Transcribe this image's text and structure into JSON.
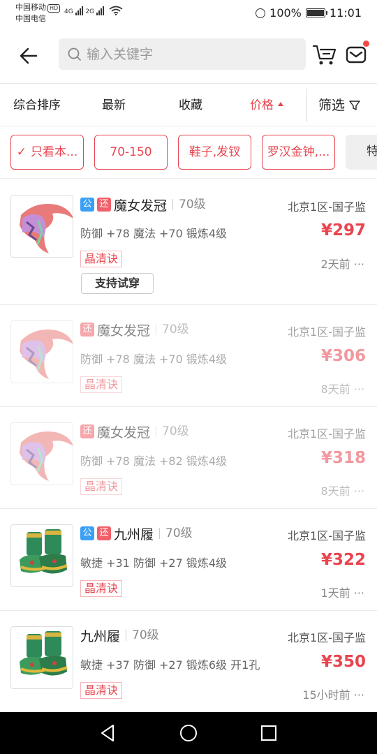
{
  "status_bar": {
    "carrier1": "中国移动",
    "hd": "HD",
    "carrier2": "中国电信",
    "net1": "4G",
    "net2": "2G",
    "battery": "100%",
    "time": "11:01"
  },
  "header": {
    "search_placeholder": "输入关键字"
  },
  "sort": {
    "items": [
      "综合排序",
      "最新",
      "收藏",
      "价格"
    ],
    "active_index": 3,
    "filter_label": "筛选"
  },
  "chips": [
    "只看本...",
    "70-150",
    "鞋子,发钗",
    "罗汉金钟,...",
    "特"
  ],
  "items": [
    {
      "tags": [
        "公",
        "还"
      ],
      "title": "魔女发冠",
      "level": "70级",
      "server": "北京1区-国子监",
      "attrs": "防御 +78 魔法 +70 锻炼4级",
      "price": "¥297",
      "skill": "晶清诀",
      "ago": "2天前 ···",
      "tryon": "支持试穿",
      "icon": "crown-icon"
    },
    {
      "tags": [
        "还"
      ],
      "title": "魔女发冠",
      "level": "70级",
      "server": "北京1区-国子监",
      "attrs": "防御 +78 魔法 +70 锻炼4级",
      "price": "¥306",
      "skill": "晶清诀",
      "ago": "8天前 ···",
      "icon": "crown-icon"
    },
    {
      "tags": [
        "还"
      ],
      "title": "魔女发冠",
      "level": "70级",
      "server": "北京1区-国子监",
      "attrs": "防御 +78 魔法 +82 锻炼4级",
      "price": "¥318",
      "skill": "晶清诀",
      "ago": "8天前 ···",
      "icon": "crown-icon"
    },
    {
      "tags": [
        "公",
        "还"
      ],
      "title": "九州履",
      "level": "70级",
      "server": "北京1区-国子监",
      "attrs": "敏捷 +31 防御 +27 锻炼4级",
      "price": "¥322",
      "skill": "晶清诀",
      "ago": "1天前 ···",
      "icon": "boots-icon"
    },
    {
      "tags": [],
      "title": "九州履",
      "level": "70级",
      "server": "北京1区-国子监",
      "attrs": "敏捷 +37 防御 +27 锻炼6级 开1孔",
      "price": "¥350",
      "skill": "晶清诀",
      "ago": "15小时前 ···",
      "icon": "boots-icon"
    }
  ],
  "colors": {
    "accent": "#e8454f",
    "tag_blue": "#3aa0f5",
    "tag_red": "#f0606a"
  }
}
